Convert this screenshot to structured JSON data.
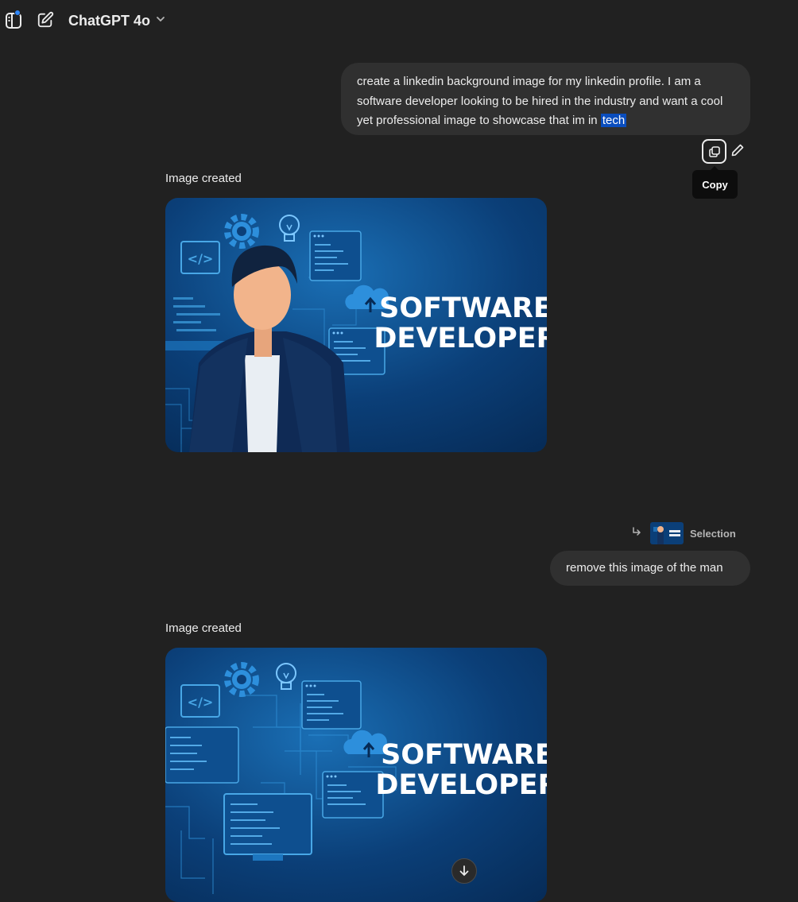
{
  "header": {
    "model_name": "ChatGPT 4o"
  },
  "messages": {
    "user_1": {
      "text_before": "create a linkedin background image for my linkedin profile.  I am a software developer looking to be hired in the industry and want a cool yet professional image to showcase that im in",
      "highlighted": "tech"
    },
    "copy_tooltip": "Copy",
    "assistant_1_status": "Image created",
    "selection_label": "Selection",
    "user_2": "remove this image of the man",
    "assistant_2_status": "Image created"
  },
  "images": {
    "headline_1": "SOFTWARE",
    "headline_2": "DEVELOPER",
    "code_tag": "</>"
  },
  "colors": {
    "background": "#212121",
    "bubble": "#303030",
    "accent_dot": "#2f86f6",
    "selection_highlight": "#0a4dbd"
  },
  "icons": {
    "sidebar_toggle": "sidebar-icon",
    "new_chat": "compose-icon",
    "model_chevron": "chevron-down-icon",
    "copy": "copy-icon",
    "edit": "pencil-icon",
    "reply": "reply-arrow-icon",
    "scroll": "arrow-down-icon"
  }
}
